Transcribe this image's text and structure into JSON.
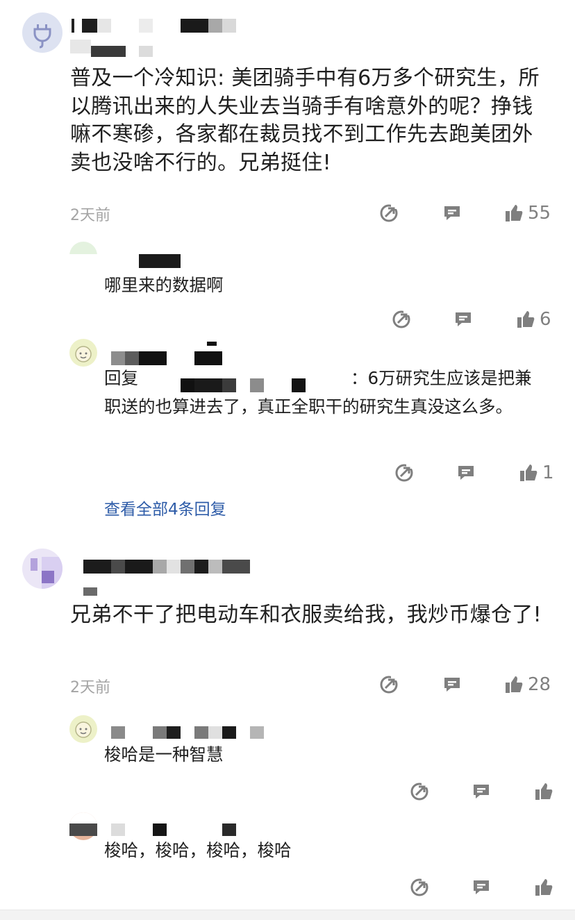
{
  "colors": {
    "text": "#1f1f1f",
    "meta": "#a4a4a4",
    "icon": "#8a8a8a",
    "link": "#2e5ca8"
  },
  "comments": [
    {
      "username": "",
      "body": "普及一个冷知识: 美团骑手中有6万多个研究生，所以腾讯出来的人失业去当骑手有啥意外的呢？挣钱嘛不寒碜，各家都在裁员找不到工作先去跑美团外卖也没啥不行的。兄弟挺住!",
      "time": "2天前",
      "likes": "55",
      "replies": [
        {
          "body": "哪里来的数据啊",
          "likes": "6"
        },
        {
          "body": "回复…：6万研究生应该是把兼职送的也算进去了，真正全职干的研究生真没这么多。",
          "prefix": "回复",
          "visible_rest": "：6万研究生应该是把兼职送的也算进去了，真正全职干的研究生真没这么多。",
          "likes": "1"
        }
      ],
      "view_all": "查看全部4条回复"
    },
    {
      "username": "",
      "body": "兄弟不干了把电动车和衣服卖给我，我炒币爆仓了!",
      "time": "2天前",
      "likes": "28",
      "replies": [
        {
          "body": "梭哈是一种智慧",
          "likes": ""
        },
        {
          "body": "梭哈，梭哈，梭哈，梭哈",
          "likes": ""
        }
      ]
    }
  ],
  "icons": {
    "share": "share-icon",
    "comment": "comment-icon",
    "like": "thumbs-up-icon"
  }
}
